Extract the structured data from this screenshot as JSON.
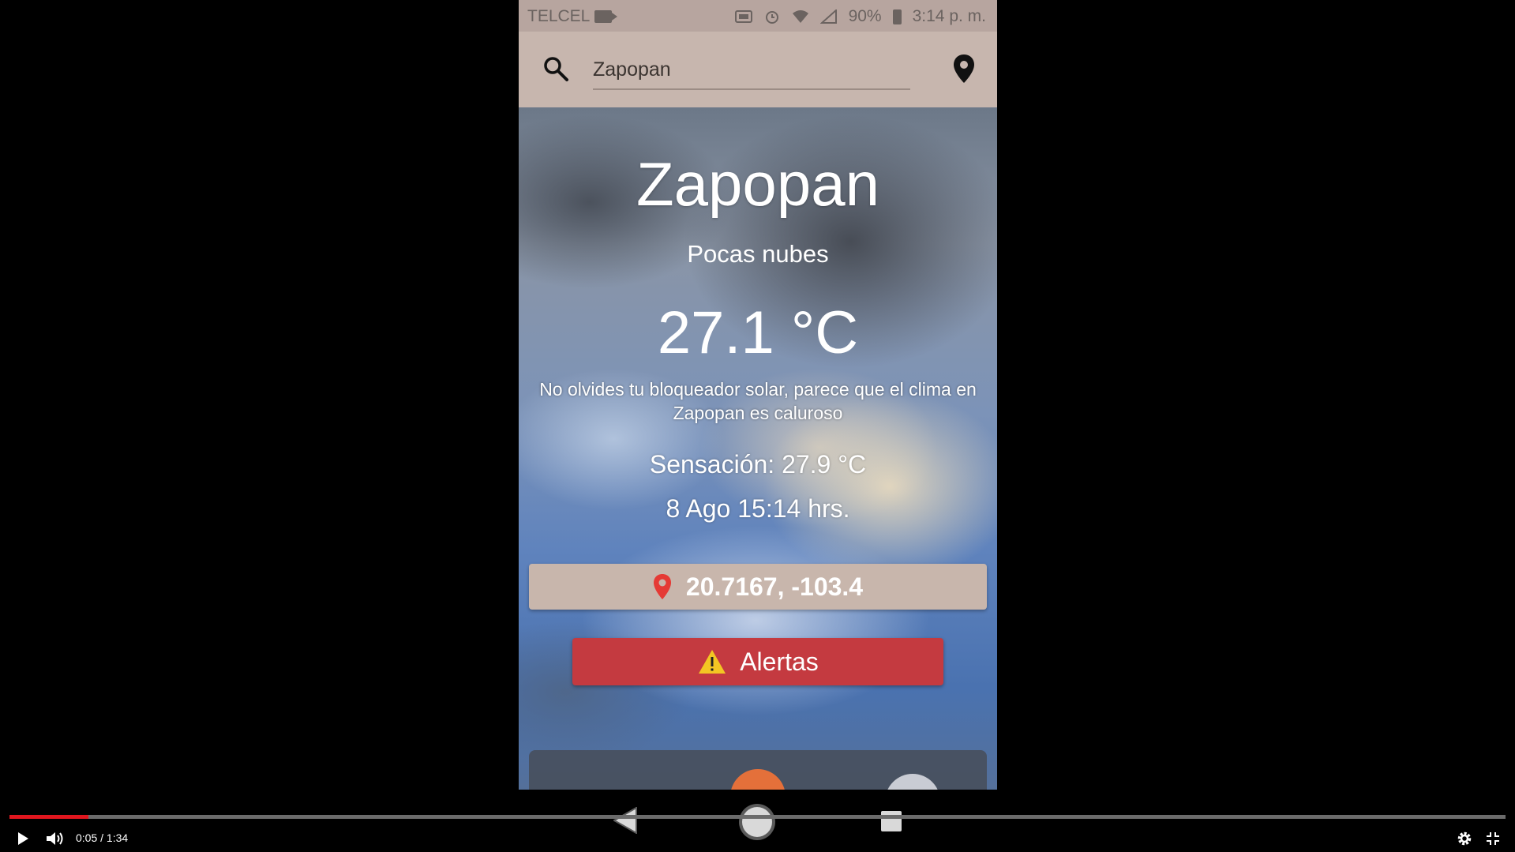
{
  "status_bar": {
    "carrier": "TELCEL",
    "battery": "90%",
    "time": "3:14 p. m."
  },
  "search": {
    "value": "Zapopan"
  },
  "weather": {
    "city": "Zapopan",
    "description": "Pocas nubes",
    "temperature": "27.1 °C",
    "tip": "No olvides tu bloqueador solar, parece que el clima en Zapopan es caluroso",
    "feels_like": "Sensación: 27.9 °C",
    "datetime": "8 Ago 15:14 hrs.",
    "coordinates": "20.7167, -103.4",
    "alerts_label": "Alertas"
  },
  "video": {
    "time": "0:05 / 1:34",
    "progress": 0.053
  },
  "colors": {
    "search_bar": "#c7b6ae",
    "alert_button": "#c43a40",
    "progress": "#e0161e"
  }
}
